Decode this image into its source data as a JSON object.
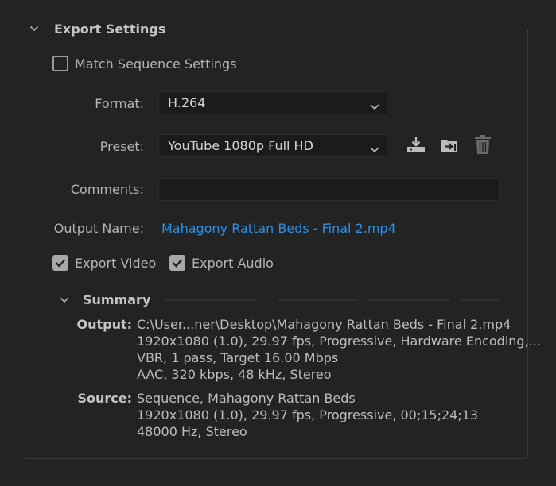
{
  "export_settings": {
    "title": "Export Settings",
    "match_sequence_label": "Match Sequence Settings",
    "match_sequence_checked": false,
    "format": {
      "label": "Format:",
      "value": "H.264"
    },
    "preset": {
      "label": "Preset:",
      "value": "YouTube 1080p Full HD"
    },
    "comments": {
      "label": "Comments:",
      "value": ""
    },
    "output_name": {
      "label": "Output Name:",
      "value": "Mahagony Rattan Beds - Final 2.mp4"
    },
    "export_video": {
      "label": "Export Video",
      "checked": true
    },
    "export_audio": {
      "label": "Export Audio",
      "checked": true
    },
    "preset_icons": [
      "save-preset-icon",
      "import-preset-icon",
      "delete-preset-icon"
    ]
  },
  "summary": {
    "title": "Summary",
    "output": {
      "label": "Output:",
      "lines": [
        "C:\\User...ner\\Desktop\\Mahagony Rattan Beds - Final 2.mp4",
        "1920x1080 (1.0), 29.97 fps, Progressive, Hardware Encoding,...",
        "VBR, 1 pass, Target 16.00 Mbps",
        "AAC, 320 kbps, 48 kHz, Stereo"
      ]
    },
    "source": {
      "label": "Source:",
      "lines": [
        "Sequence, Mahagony Rattan Beds",
        "1920x1080 (1.0), 29.97 fps, Progressive, 00;15;24;13",
        "48000 Hz, Stereo"
      ]
    }
  },
  "colors": {
    "background": "#232323",
    "field_bg": "#1b1b1b",
    "link": "#2f8fe0",
    "text": "#b5b5b5"
  }
}
